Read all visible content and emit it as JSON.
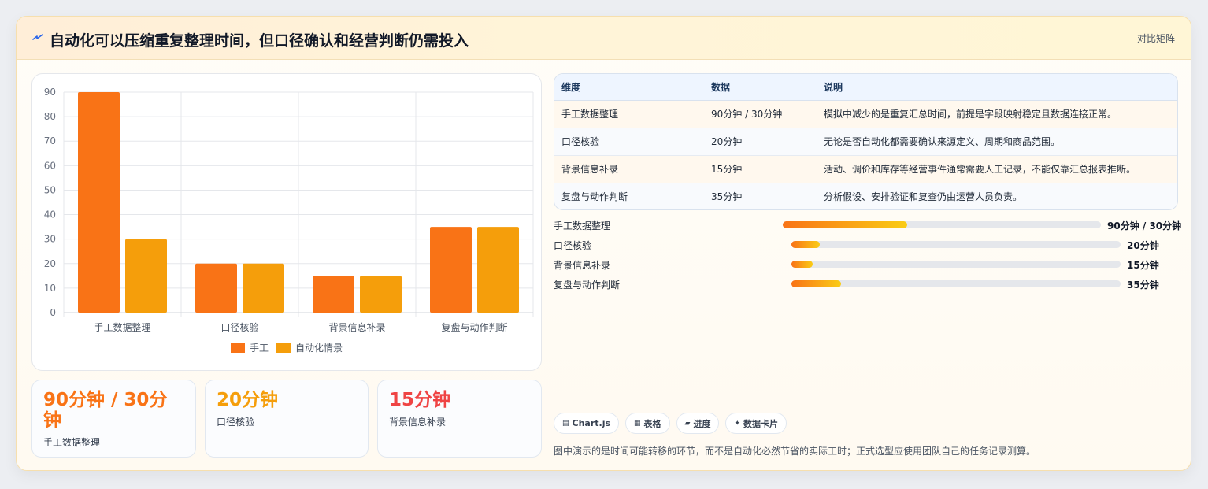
{
  "header": {
    "title": "自动化可以压缩重复整理时间，但口径确认和经营判断仍需投入",
    "tag": "对比矩阵",
    "icon": "lightning-icon"
  },
  "colors": {
    "manual": "#f97316",
    "auto": "#f59e0b",
    "stat1": "#f97316",
    "stat2": "#f59e0b",
    "stat3": "#ef4444"
  },
  "chart_data": {
    "type": "bar",
    "categories": [
      "手工数据整理",
      "口径核验",
      "背景信息补录",
      "复盘与动作判断"
    ],
    "series": [
      {
        "name": "手工",
        "values": [
          90,
          20,
          15,
          35
        ]
      },
      {
        "name": "自动化情景",
        "values": [
          30,
          20,
          15,
          35
        ]
      }
    ],
    "ylim": [
      0,
      90
    ],
    "yticks": [
      0,
      10,
      20,
      30,
      40,
      50,
      60,
      70,
      80,
      90
    ],
    "grid": true,
    "legend": "bottom"
  },
  "stats": [
    {
      "value": "90分钟 / 30分钟",
      "label": "手工数据整理"
    },
    {
      "value": "20分钟",
      "label": "口径核验"
    },
    {
      "value": "15分钟",
      "label": "背景信息补录"
    }
  ],
  "table": {
    "headers": [
      "维度",
      "数据",
      "说明"
    ],
    "rows": [
      {
        "dim": "手工数据整理",
        "data": "90分钟 / 30分钟",
        "desc": "模拟中减少的是重复汇总时间，前提是字段映射稳定且数据连接正常。"
      },
      {
        "dim": "口径核验",
        "data": "20分钟",
        "desc": "无论是否自动化都需要确认来源定义、周期和商品范围。"
      },
      {
        "dim": "背景信息补录",
        "data": "15分钟",
        "desc": "活动、调价和库存等经营事件通常需要人工记录，不能仅靠汇总报表推断。"
      },
      {
        "dim": "复盘与动作判断",
        "data": "35分钟",
        "desc": "分析假设、安排验证和复查仍由运营人员负责。"
      }
    ]
  },
  "progress": [
    {
      "label": "手工数据整理",
      "value": "90分钟 / 30分钟",
      "fraction": 0.39
    },
    {
      "label": "口径核验",
      "value": "20分钟",
      "fraction": 0.086
    },
    {
      "label": "背景信息补录",
      "value": "15分钟",
      "fraction": 0.064
    },
    {
      "label": "复盘与动作判断",
      "value": "35分钟",
      "fraction": 0.15
    }
  ],
  "chips": [
    {
      "icon": "chart-icon",
      "glyph": "▤",
      "label": "Chart.js"
    },
    {
      "icon": "table-icon",
      "glyph": "▦",
      "label": "表格"
    },
    {
      "icon": "progress-icon",
      "glyph": "▰",
      "label": "进度"
    },
    {
      "icon": "card-icon",
      "glyph": "✦",
      "label": "数据卡片"
    }
  ],
  "footnote": "图中演示的是时间可能转移的环节，而不是自动化必然节省的实际工时；正式选型应使用团队自己的任务记录测算。"
}
